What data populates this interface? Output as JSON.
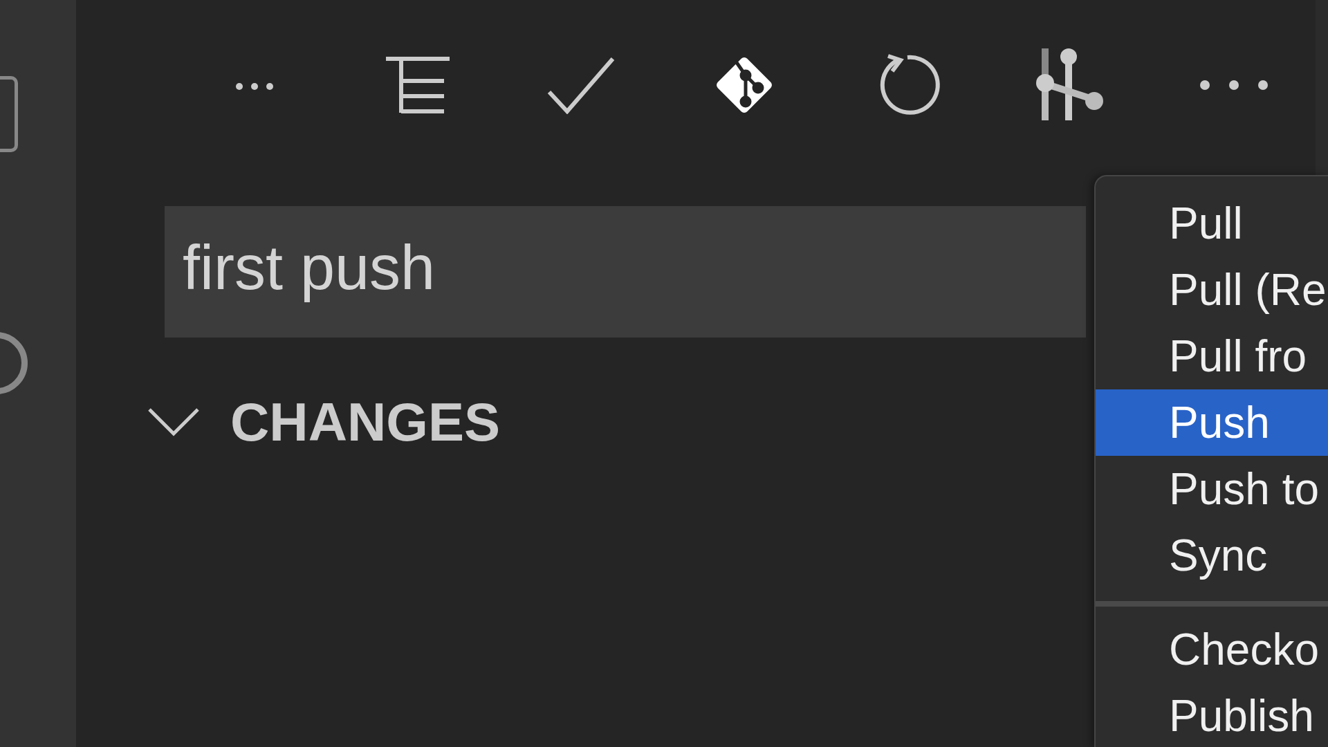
{
  "toolbar": {
    "actions": [
      {
        "kind": "ellipsis"
      },
      {
        "kind": "tree"
      },
      {
        "kind": "check"
      },
      {
        "kind": "git"
      },
      {
        "kind": "refresh"
      },
      {
        "kind": "compare"
      },
      {
        "kind": "more"
      }
    ]
  },
  "message_input": {
    "value": "first push"
  },
  "changes_section": {
    "title": "CHANGES",
    "expanded": true
  },
  "context_menu": {
    "groups": [
      [
        {
          "label": "Pull",
          "selected": false
        },
        {
          "label": "Pull (Re",
          "selected": false
        },
        {
          "label": "Pull fro",
          "selected": false
        },
        {
          "label": "Push",
          "selected": true
        },
        {
          "label": "Push to",
          "selected": false
        },
        {
          "label": "Sync",
          "selected": false
        }
      ],
      [
        {
          "label": "Checko",
          "selected": false
        },
        {
          "label": "Publish",
          "selected": false
        }
      ]
    ]
  }
}
